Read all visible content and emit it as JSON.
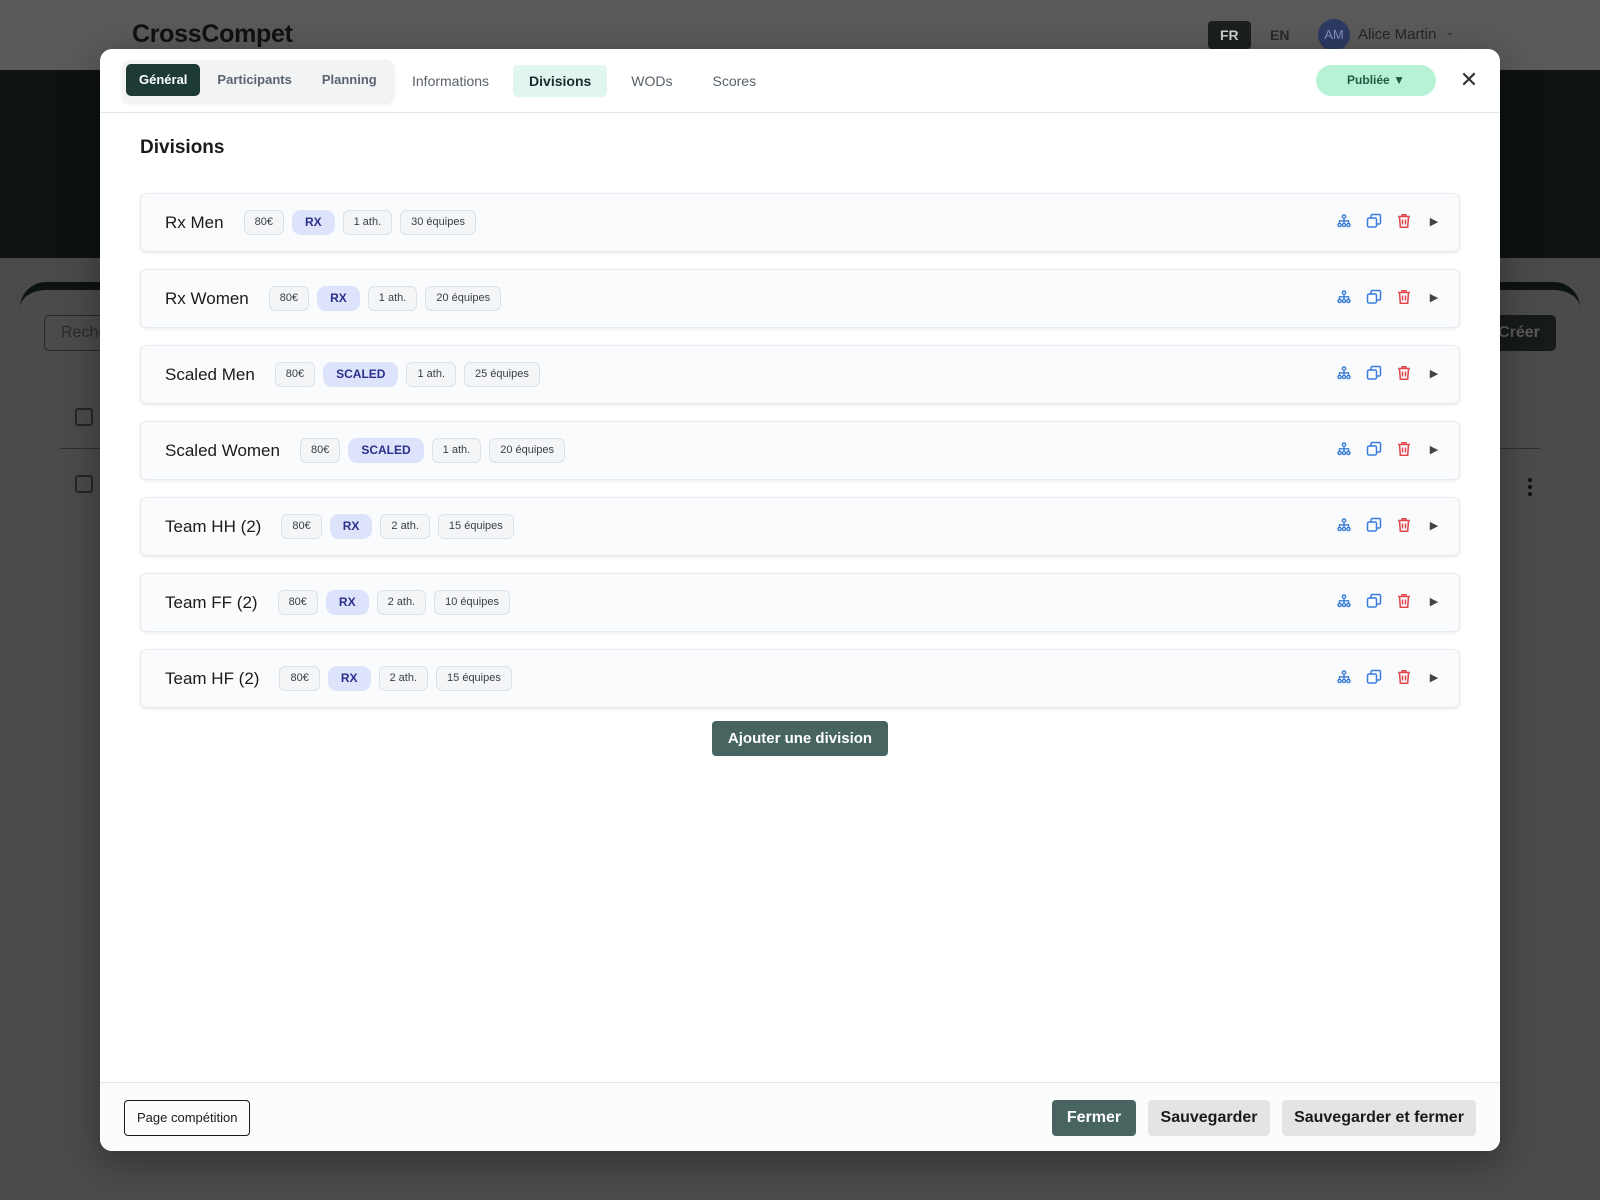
{
  "app": {
    "title": "CrossCompet",
    "languages": [
      "FR",
      "EN"
    ],
    "active_language": "FR",
    "user": {
      "initials": "AM",
      "name": "Alice Martin"
    },
    "search_placeholder": "Reche",
    "create_label": "Créer"
  },
  "modal": {
    "segments": [
      {
        "label": "Général",
        "active": true
      },
      {
        "label": "Participants",
        "active": false
      },
      {
        "label": "Planning",
        "active": false
      }
    ],
    "tabs": [
      {
        "label": "Informations",
        "active": false
      },
      {
        "label": "Divisions",
        "active": true
      },
      {
        "label": "WODs",
        "active": false
      },
      {
        "label": "Scores",
        "active": false
      }
    ],
    "status": "Publiée",
    "status_caret": "▼",
    "close_glyph": "✕",
    "section_title": "Divisions",
    "divisions": [
      {
        "name": "Rx Men",
        "price": "80€",
        "level": "RX",
        "athletes": "1 ath.",
        "teams": "30 équipes"
      },
      {
        "name": "Rx Women",
        "price": "80€",
        "level": "RX",
        "athletes": "1 ath.",
        "teams": "20 équipes"
      },
      {
        "name": "Scaled Men",
        "price": "80€",
        "level": "SCALED",
        "athletes": "1 ath.",
        "teams": "25 équipes"
      },
      {
        "name": "Scaled Women",
        "price": "80€",
        "level": "SCALED",
        "athletes": "1 ath.",
        "teams": "20 équipes"
      },
      {
        "name": "Team HH (2)",
        "price": "80€",
        "level": "RX",
        "athletes": "2 ath.",
        "teams": "15 équipes"
      },
      {
        "name": "Team FF (2)",
        "price": "80€",
        "level": "RX",
        "athletes": "2 ath.",
        "teams": "10 équipes"
      },
      {
        "name": "Team HF (2)",
        "price": "80€",
        "level": "RX",
        "athletes": "2 ath.",
        "teams": "15 équipes"
      }
    ],
    "add_division_label": "Ajouter une division",
    "footer": {
      "page_link": "Page compétition",
      "close": "Fermer",
      "save": "Sauvegarder",
      "save_close": "Sauvegarder et fermer"
    }
  },
  "colors": {
    "primary_dark": "#1d3a35",
    "primary": "#476461",
    "status_bg": "#b8f2d6",
    "level_bg": "#dde3fb",
    "action_blue": "#3b7dd8",
    "action_red": "#e0474c"
  },
  "icons": {
    "org": "sitemap-icon",
    "duplicate": "copy-icon",
    "delete": "trash-icon",
    "expand": "play-right-icon"
  }
}
